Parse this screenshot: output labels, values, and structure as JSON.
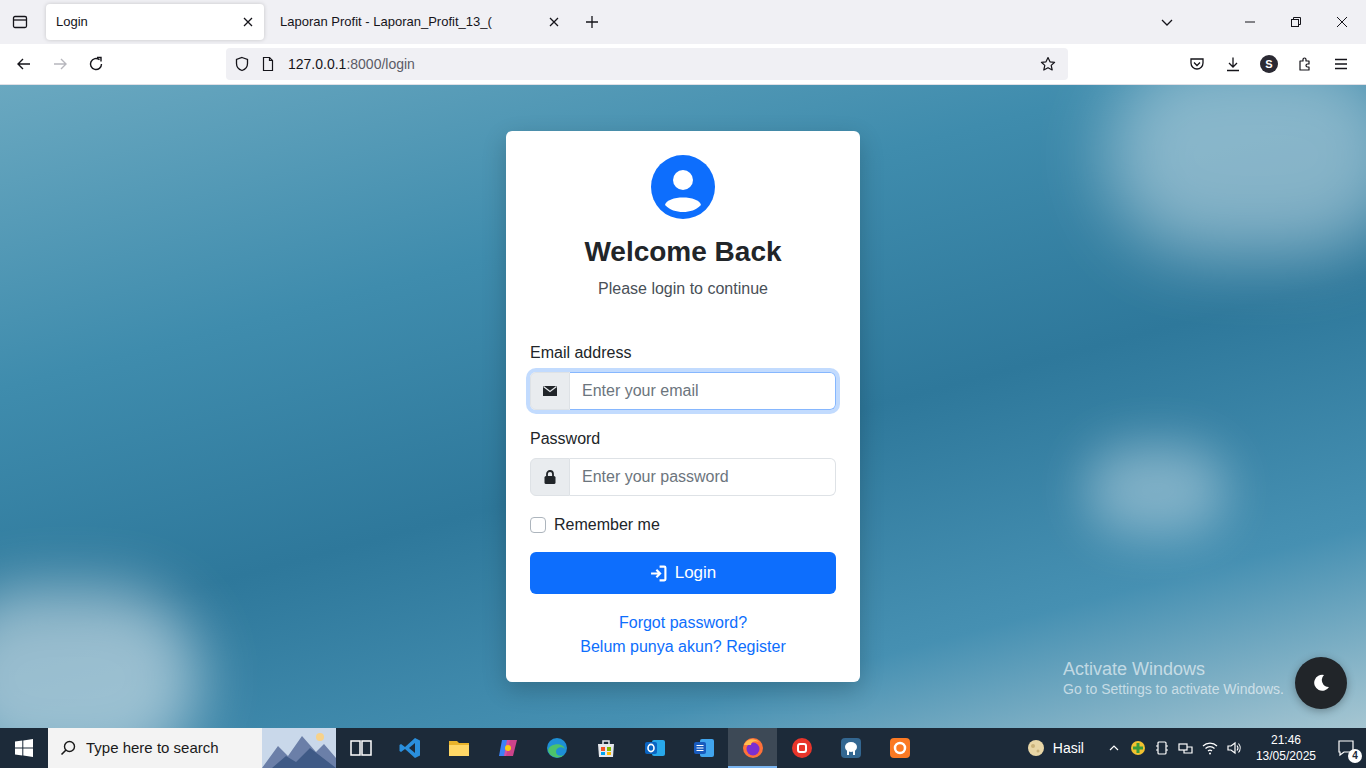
{
  "browser": {
    "tabs": [
      {
        "label": "Login",
        "selected": true
      },
      {
        "label": "Laporan Profit - Laporan_Profit_13_(",
        "selected": false
      }
    ],
    "address": {
      "host": "127.0.0.1",
      "path": ":8000/login"
    },
    "profile": "S"
  },
  "login": {
    "title": "Welcome Back",
    "subtitle": "Please login to continue",
    "fields": [
      {
        "label": "Email address",
        "placeholder": "Enter your email",
        "focused": true,
        "kind": "email"
      },
      {
        "label": "Password",
        "placeholder": "Enter your password",
        "focused": false,
        "kind": "password"
      }
    ],
    "remember": {
      "label": "Remember me",
      "checked": false
    },
    "submit": "Login",
    "links": [
      "Forgot password?",
      "Belum punya akun? Register"
    ]
  },
  "watermark": {
    "title": "Activate Windows",
    "subtitle": "Go to Settings to activate Windows."
  },
  "taskbar": {
    "search": "Type here to search",
    "apps": [
      {
        "kind": "task-view",
        "active": false
      },
      {
        "kind": "vscode",
        "active": false
      },
      {
        "kind": "explorer",
        "active": false
      },
      {
        "kind": "copilot",
        "active": false
      },
      {
        "kind": "edge",
        "active": false
      },
      {
        "kind": "store",
        "active": false
      },
      {
        "kind": "outlook",
        "active": false
      },
      {
        "kind": "word",
        "active": false
      },
      {
        "kind": "firefox",
        "active": true
      },
      {
        "kind": "wps",
        "active": false
      },
      {
        "kind": "pgadmin",
        "active": false
      },
      {
        "kind": "xampp",
        "active": false
      }
    ],
    "weather": "Hasil",
    "time": "21:46",
    "date": "13/05/2025",
    "notifications": "4"
  }
}
